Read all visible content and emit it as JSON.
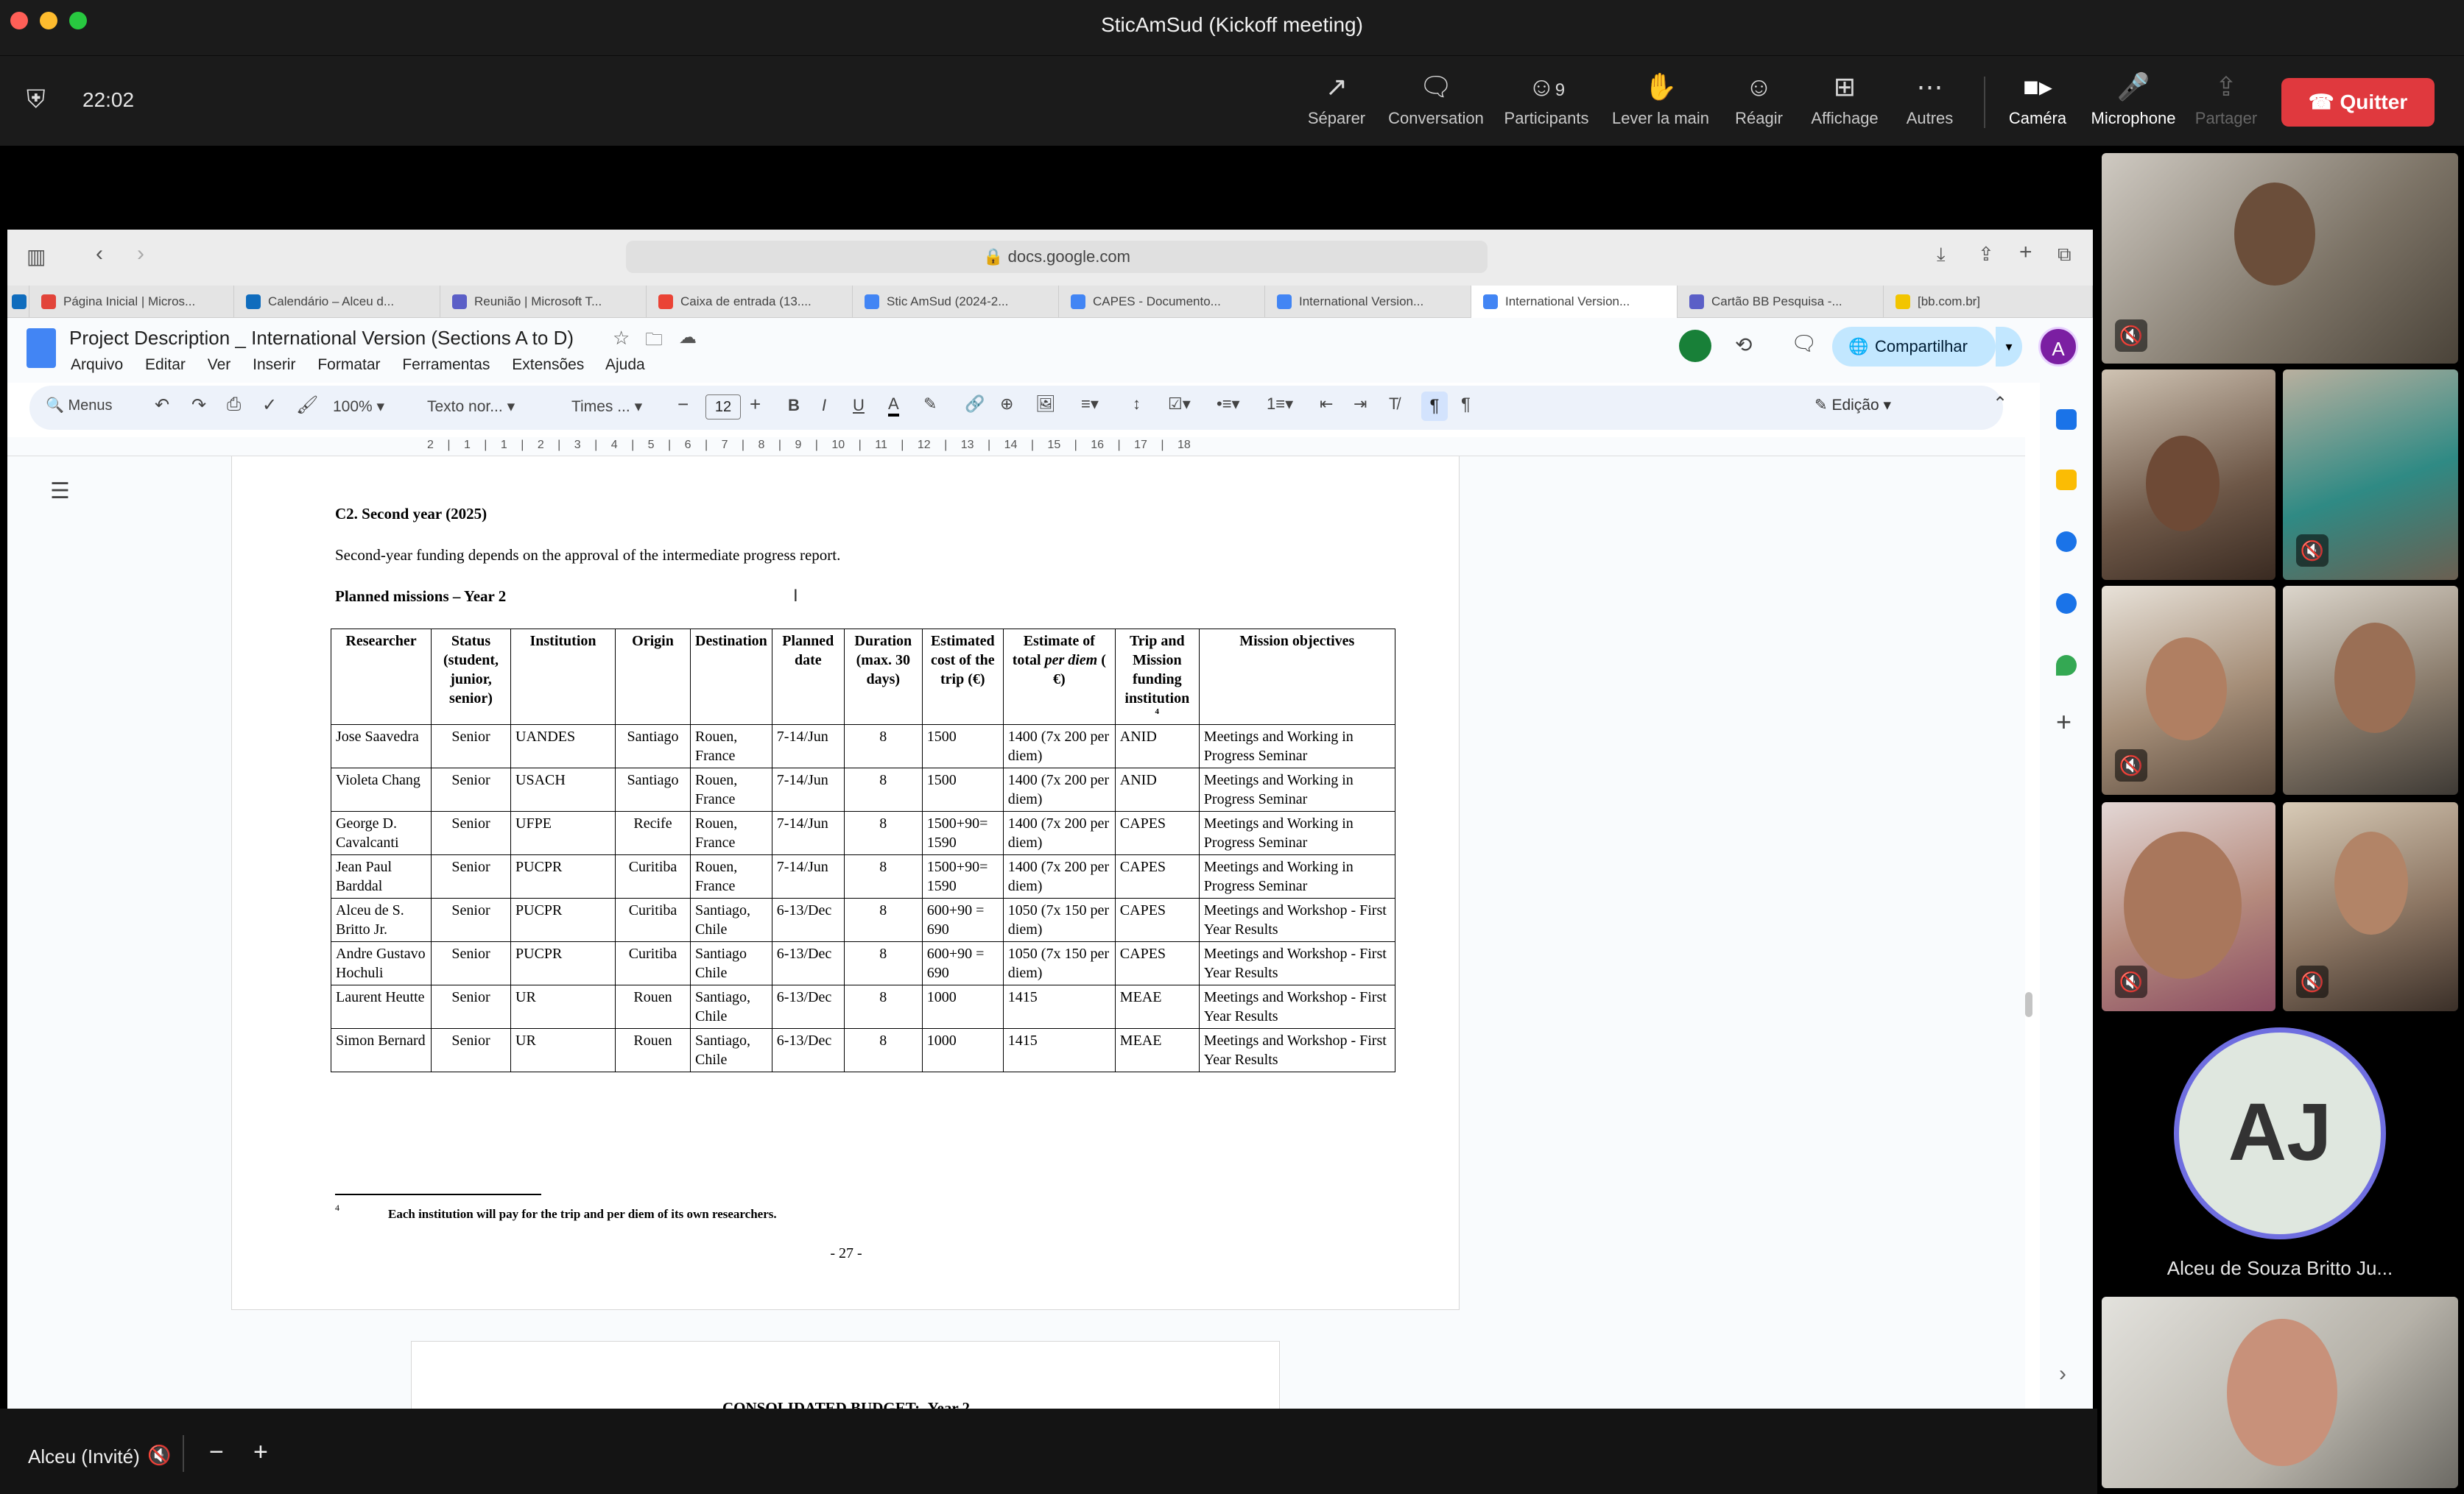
{
  "window": {
    "title": "SticAmSud (Kickoff meeting)"
  },
  "meeting": {
    "elapsed": "22:02",
    "participants_count": "9"
  },
  "toolbar": {
    "separate": "Séparer",
    "chat": "Conversation",
    "participants": "Participants",
    "raise_hand": "Lever la main",
    "react": "Réagir",
    "view": "Affichage",
    "more": "Autres",
    "camera": "Caméra",
    "microphone": "Microphone",
    "share": "Partager",
    "quit": "Quitter"
  },
  "browser": {
    "url": "docs.google.com",
    "tabs": [
      {
        "label": "Página Inicial | Micros...",
        "color": "#e2443a"
      },
      {
        "label": "Calendário – Alceu d...",
        "color": "#0f6cbd"
      },
      {
        "label": "Reunião | Microsoft T...",
        "color": "#5b5fc7"
      },
      {
        "label": "Caixa de entrada (13....",
        "color": "#ea4335"
      },
      {
        "label": "Stic AmSud (2024-2...",
        "color": "#4285f4"
      },
      {
        "label": "CAPES - Documento...",
        "color": "#4285f4"
      },
      {
        "label": "International Version...",
        "color": "#4285f4"
      },
      {
        "label": "International Version...",
        "color": "#4285f4"
      },
      {
        "label": "Cartão BB Pesquisa -...",
        "color": "#5b5fc7"
      },
      {
        "label": "[bb.com.br]",
        "color": "#f2c500"
      }
    ]
  },
  "docs": {
    "title": "Project Description _ International Version (Sections A to D)",
    "menus": [
      "Arquivo",
      "Editar",
      "Ver",
      "Inserir",
      "Formatar",
      "Ferramentas",
      "Extensões",
      "Ajuda"
    ],
    "share_label": "Compartilhar",
    "avatar_letter": "A",
    "format": {
      "search": "Menus",
      "zoom": "100%",
      "style": "Texto nor...",
      "font": "Times ...",
      "size": "12",
      "mode": "Edição"
    },
    "ruler": "2 | 1 | 1 | 2 | 3 | 4 | 5 | 6 | 7 | 8 | 9 | 10 | 11 | 12 | 13 | 14 | 15 | 16 | 17 | 18"
  },
  "doc_content": {
    "section_heading": "C2. Second year (2025)",
    "intro": "Second-year funding depends on the approval of the intermediate progress report.",
    "table_heading": "Planned missions – Year 2",
    "columns": [
      "Researcher",
      "Status (student, junior, senior)",
      "Institution",
      "Origin",
      "Destination",
      "Planned date",
      "Duration (max. 30 days)",
      "Estimated cost of the trip (€)",
      "Estimate of total per diem ( €)",
      "Trip and Mission funding institution",
      "Mission objectives"
    ],
    "rows": [
      [
        "Jose Saavedra",
        "Senior",
        "UANDES",
        "Santiago",
        "Rouen, France",
        "7-14/Jun",
        "8",
        "1500",
        "1400 (7x 200 per diem)",
        "ANID",
        "Meetings and Working in Progress Seminar"
      ],
      [
        "Violeta Chang",
        "Senior",
        "USACH",
        "Santiago",
        "Rouen, France",
        "7-14/Jun",
        "8",
        "1500",
        "1400 (7x 200 per diem)",
        "ANID",
        "Meetings and Working in Progress Seminar"
      ],
      [
        "George D. Cavalcanti",
        "Senior",
        "UFPE",
        "Recife",
        "Rouen, France",
        "7-14/Jun",
        "8",
        "1500+90= 1590",
        "1400 (7x 200 per diem)",
        "CAPES",
        "Meetings and Working in Progress Seminar"
      ],
      [
        "Jean Paul Barddal",
        "Senior",
        "PUCPR",
        "Curitiba",
        "Rouen, France",
        "7-14/Jun",
        "8",
        "1500+90= 1590",
        "1400 (7x 200 per diem)",
        "CAPES",
        "Meetings and Working in Progress Seminar"
      ],
      [
        "Alceu de S. Britto Jr.",
        "Senior",
        "PUCPR",
        "Curitiba",
        "Santiago, Chile",
        "6-13/Dec",
        "8",
        "600+90 = 690",
        "1050 (7x 150 per diem)",
        "CAPES",
        "Meetings and Workshop - First Year Results"
      ],
      [
        "Andre Gustavo Hochuli",
        "Senior",
        "PUCPR",
        "Curitiba",
        "Santiago Chile",
        "6-13/Dec",
        "8",
        "600+90 = 690",
        "1050 (7x 150 per diem)",
        "CAPES",
        "Meetings and Workshop - First Year Results"
      ],
      [
        "Laurent Heutte",
        "Senior",
        "UR",
        "Rouen",
        "Santiago, Chile",
        "6-13/Dec",
        "8",
        "1000",
        "1415",
        "MEAE",
        "Meetings and Workshop - First Year Results"
      ],
      [
        "Simon Bernard",
        "Senior",
        "UR",
        "Rouen",
        "Santiago, Chile",
        "6-13/Dec",
        "8",
        "1000",
        "1415",
        "MEAE",
        "Meetings and Workshop - First Year Results"
      ]
    ],
    "footnote_mark": "4",
    "footnote": "Each institution will pay for the trip and per diem of its own researchers.",
    "page_number": "- 27 -",
    "next_heading": "CONSOLIDATED BUDGET:",
    "next_heading_suffix": "Year 2"
  },
  "participants": {
    "avatar_initials": "AJ",
    "avatar_name": "Alceu de Souza Britto Ju..."
  },
  "self_view": {
    "name": "Alceu (Invité)"
  }
}
